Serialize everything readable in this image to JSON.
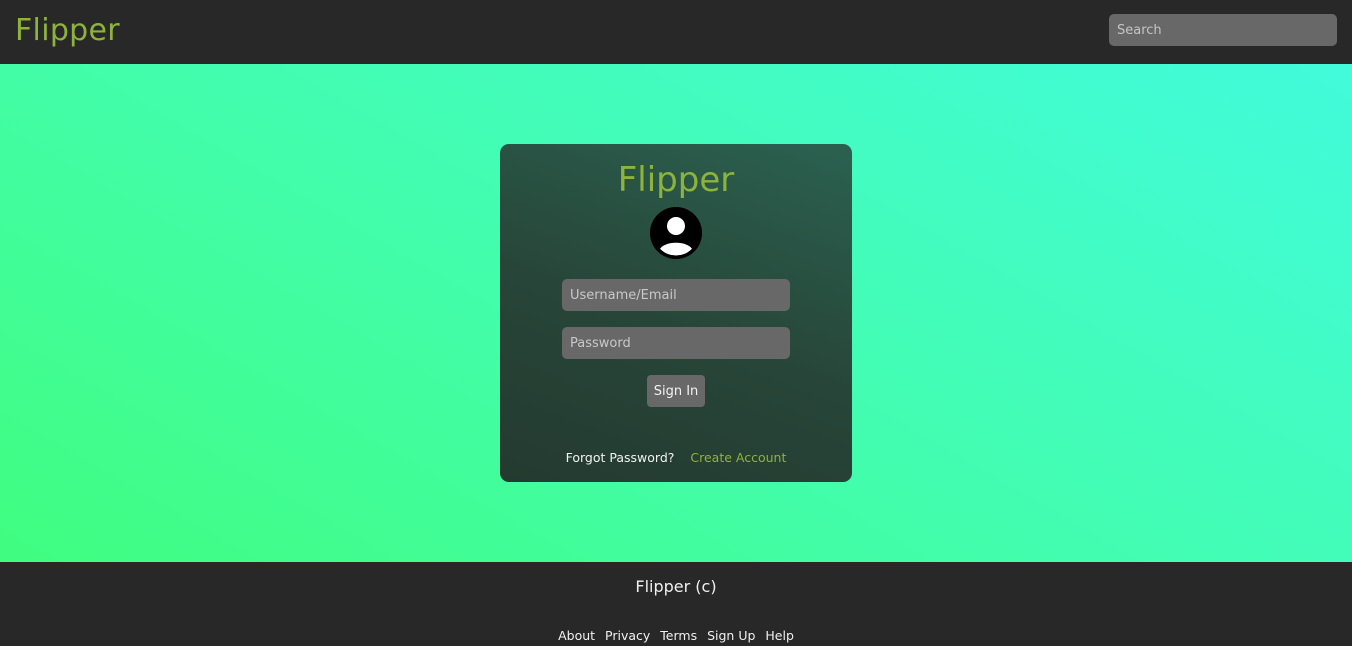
{
  "header": {
    "brand": "Flipper",
    "search_placeholder": "Search"
  },
  "login": {
    "title": "Flipper",
    "username_placeholder": "Username/Email",
    "password_placeholder": "Password",
    "signin_label": "Sign In",
    "forgot_label": "Forgot Password?",
    "create_label": "Create Account"
  },
  "footer": {
    "title": "Flipper (c)",
    "links": [
      "About",
      "Privacy",
      "Terms",
      "Sign Up",
      "Help"
    ]
  },
  "colors": {
    "brand": "#8db33c",
    "bar": "#282828",
    "input": "#686868"
  },
  "icons": {
    "avatar": "user-avatar-icon"
  }
}
